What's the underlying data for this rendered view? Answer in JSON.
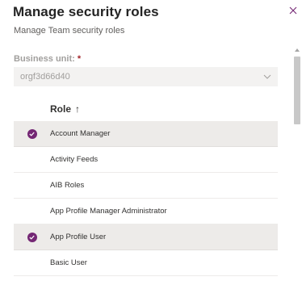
{
  "dialog": {
    "title": "Manage security roles",
    "subtitle": "Manage Team security roles",
    "close_icon": "close-icon"
  },
  "business_unit": {
    "label": "Business unit:",
    "required_marker": "*",
    "value": "orgf3d66d40",
    "icon": "chevron-down-icon"
  },
  "roles_grid": {
    "column_header": "Role",
    "sort_indicator": "↑",
    "rows": [
      {
        "name": "Account Manager",
        "selected": true
      },
      {
        "name": "Activity Feeds",
        "selected": false
      },
      {
        "name": "AIB Roles",
        "selected": false
      },
      {
        "name": "App Profile Manager Administrator",
        "selected": false
      },
      {
        "name": "App Profile User",
        "selected": true
      },
      {
        "name": "Basic User",
        "selected": false
      }
    ]
  },
  "colors": {
    "accent": "#742774",
    "selected_row": "#edebe9",
    "field_bg": "#f3f2f1"
  }
}
